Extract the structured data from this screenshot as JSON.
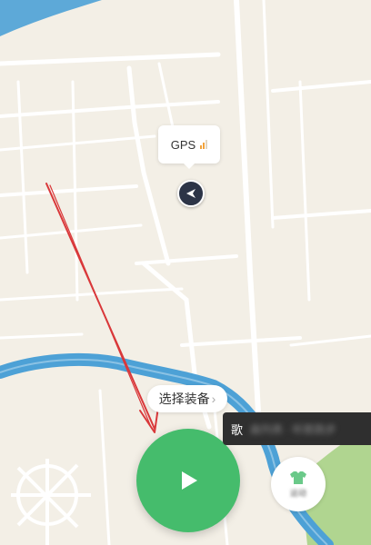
{
  "gps": {
    "label": "GPS",
    "signal_level": 2,
    "signal_max": 3,
    "signal_color": "#f2a33b"
  },
  "equipment": {
    "label": "选择装备",
    "chevron": "›"
  },
  "start": {
    "icon": "play-icon",
    "color": "#45bc6c"
  },
  "song_panel": {
    "label": "歌",
    "blurred_text": "曲列表 · 听歌跑步"
  },
  "side_button": {
    "label": "运动",
    "icon": "shirt-icon"
  },
  "annotation": {
    "color": "#d9383a"
  },
  "colors": {
    "river": "#4da1d6",
    "park": "#9fce7a",
    "land": "#f3efe6",
    "road": "#ffffff"
  }
}
